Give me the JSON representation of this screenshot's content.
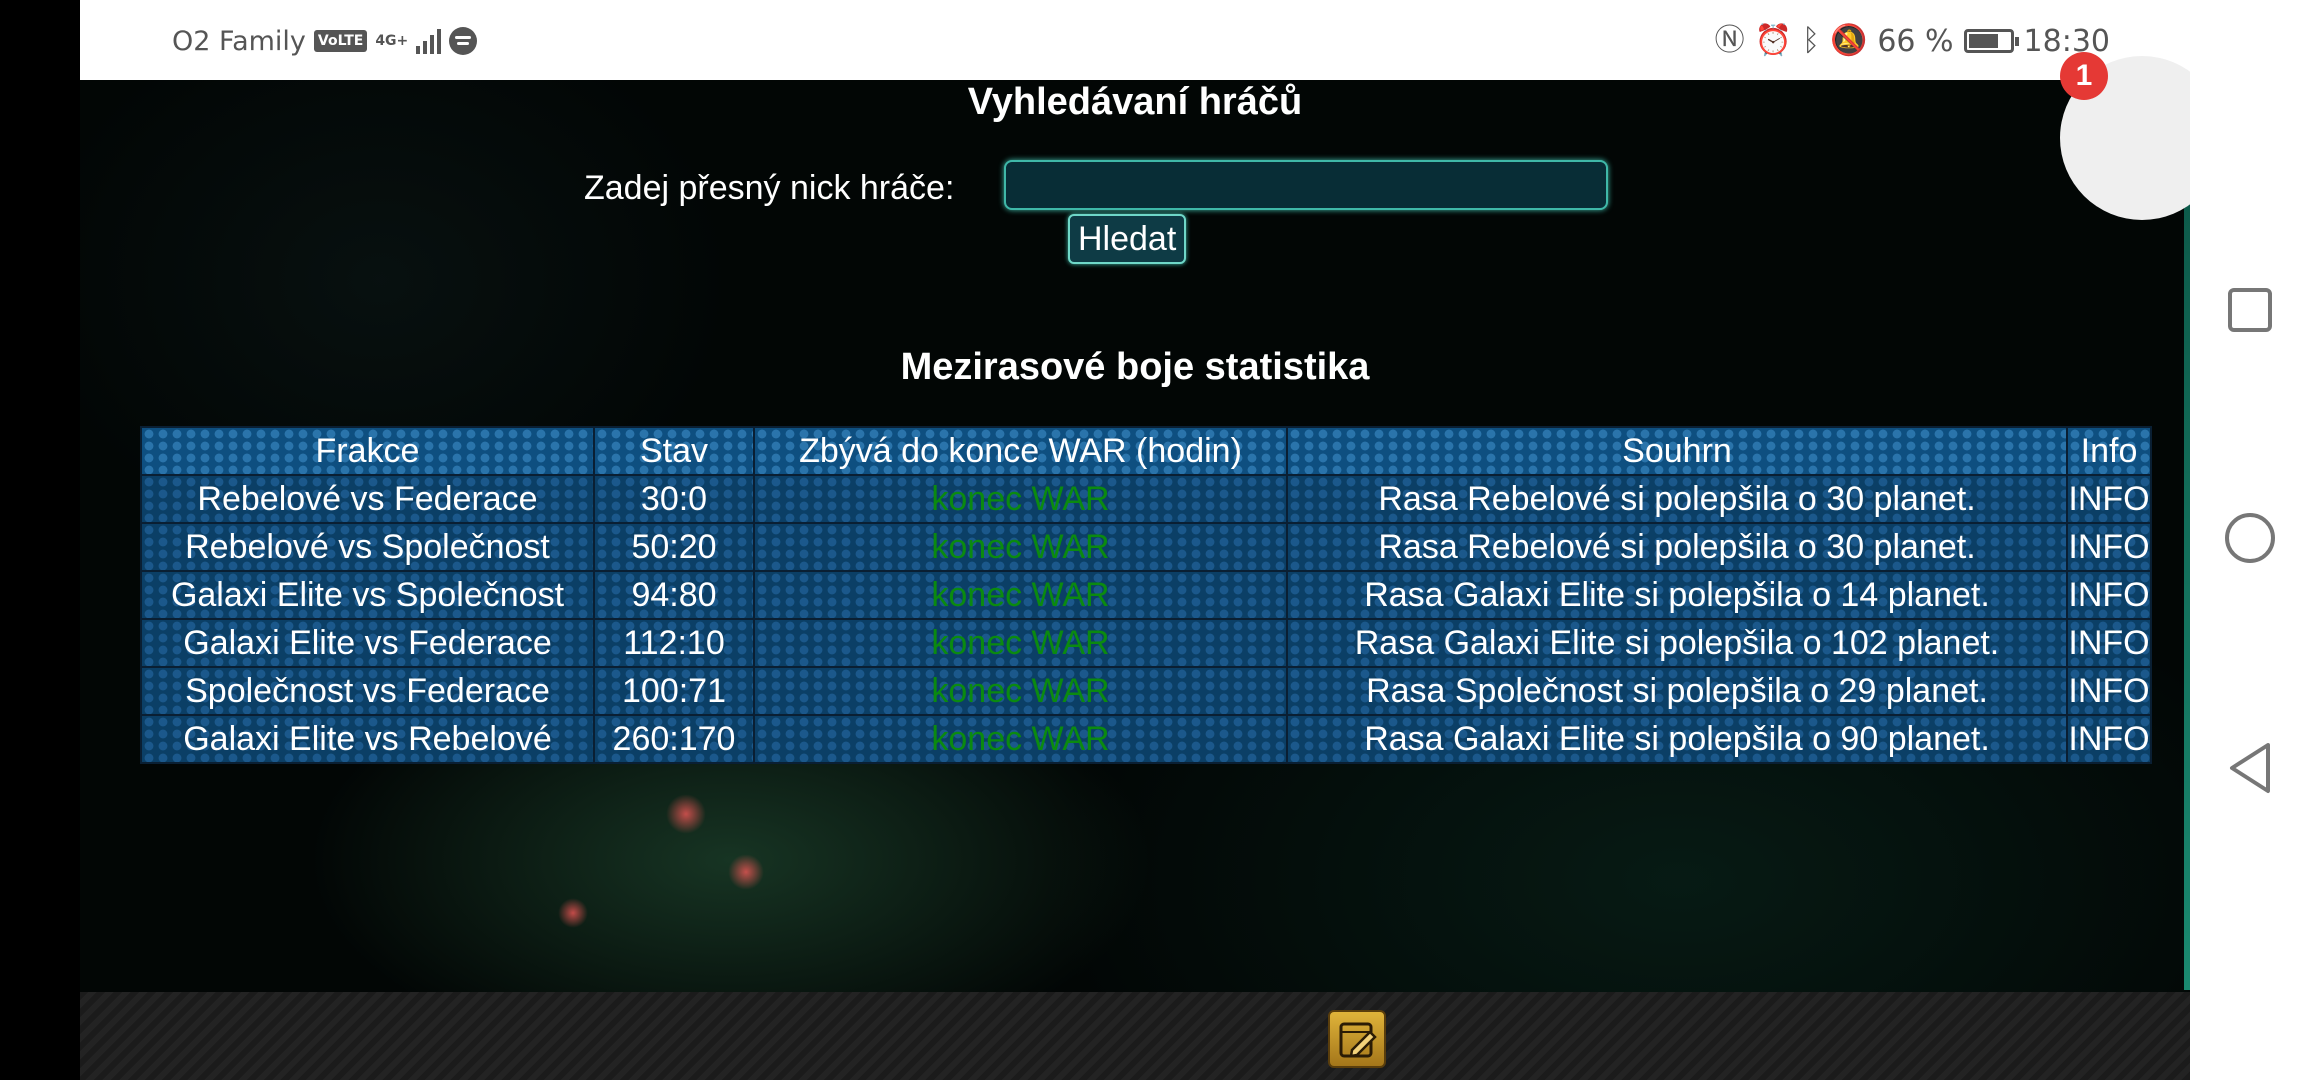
{
  "status_bar": {
    "carrier": "O2 Family",
    "volte": "VoLTE",
    "network": "4G+",
    "battery_percent": "66 %",
    "battery_level": 0.66,
    "time": "18:30",
    "icons": [
      "volte-icon",
      "signal-icon",
      "spotify-icon",
      "nfc-icon",
      "alarm-icon",
      "bluetooth-icon",
      "mute-icon",
      "battery-icon"
    ]
  },
  "search": {
    "title": "Vyhledávaní hráčů",
    "label": "Zadej přesný nick hráče:",
    "input_value": "",
    "button_label": "Hledat"
  },
  "stats": {
    "title": "Mezirasové boje statistika",
    "columns": [
      "Frakce",
      "Stav",
      "Zbývá do konce WAR (hodin)",
      "Souhrn",
      "Info"
    ],
    "rows": [
      {
        "frakce": "Rebelové vs Federace",
        "stav": "30:0",
        "zbyva": "konec WAR",
        "souhrn": "Rasa Rebelové si polepšila o 30 planet.",
        "info": "INFO"
      },
      {
        "frakce": "Rebelové vs Společnost",
        "stav": "50:20",
        "zbyva": "konec WAR",
        "souhrn": "Rasa Rebelové si polepšila o 30 planet.",
        "info": "INFO"
      },
      {
        "frakce": "Galaxi Elite vs Společnost",
        "stav": "94:80",
        "zbyva": "konec WAR",
        "souhrn": "Rasa Galaxi Elite si polepšila o 14 planet.",
        "info": "INFO"
      },
      {
        "frakce": "Galaxi Elite vs Federace",
        "stav": "112:10",
        "zbyva": "konec WAR",
        "souhrn": "Rasa Galaxi Elite si polepšila o 102 planet.",
        "info": "INFO"
      },
      {
        "frakce": "Společnost vs Federace",
        "stav": "100:71",
        "zbyva": "konec WAR",
        "souhrn": "Rasa Společnost si polepšila o 29 planet.",
        "info": "INFO"
      },
      {
        "frakce": "Galaxi Elite vs Rebelové",
        "stav": "260:170",
        "zbyva": "konec WAR",
        "souhrn": "Rasa Galaxi Elite si polepšila o 90 planet.",
        "info": "INFO"
      }
    ]
  },
  "notification": {
    "badge_count": "1"
  },
  "bottom_bar": {
    "icon": "edit-note-icon"
  },
  "nav": {
    "icons": [
      "recents-square-icon",
      "home-circle-icon",
      "back-triangle-icon"
    ]
  },
  "colors": {
    "accent": "#3fb8a8",
    "table_cell": "#0b3f66",
    "war_end_text": "#0b8a10",
    "badge": "#e53935"
  }
}
